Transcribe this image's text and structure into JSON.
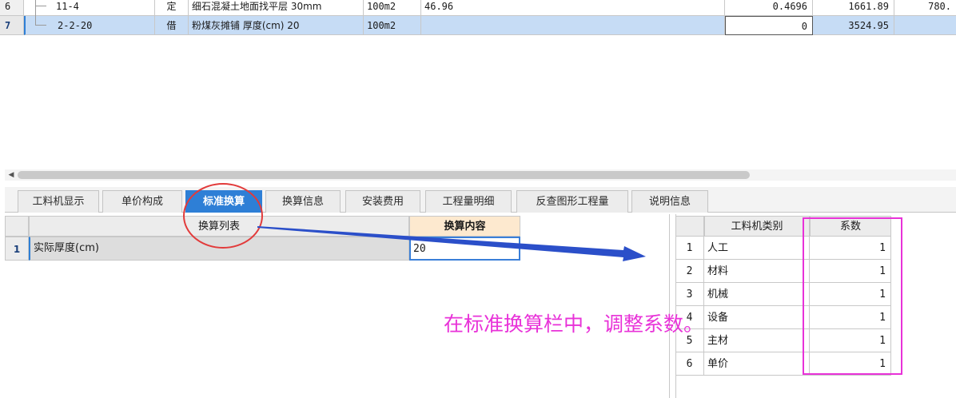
{
  "top_rows": [
    {
      "num": "6",
      "code": "11-4",
      "type": "定",
      "name": "细石混凝土地面找平层 30mm",
      "unit": "100m2",
      "expr": "46.96",
      "qty": "0.4696",
      "price": "1661.89",
      "total": "780."
    },
    {
      "num": "7",
      "code": "2-2-20",
      "type": "借",
      "name": "粉煤灰摊铺 厚度(cm) 20",
      "unit": "100m2",
      "expr": "",
      "qty": "0",
      "price": "3524.95",
      "total": ""
    }
  ],
  "tabs": [
    "工料机显示",
    "单价构成",
    "标准换算",
    "换算信息",
    "安装费用",
    "工程量明细",
    "反查图形工程量",
    "说明信息"
  ],
  "active_tab": "标准换算",
  "left_grid": {
    "headers": [
      "换算列表",
      "换算内容"
    ],
    "rows": [
      {
        "num": "1",
        "name": "实际厚度(cm)",
        "value": "20"
      }
    ]
  },
  "right_grid": {
    "headers": [
      "工料机类别",
      "系数"
    ],
    "rows": [
      {
        "num": "1",
        "category": "人工",
        "factor": "1"
      },
      {
        "num": "2",
        "category": "材料",
        "factor": "1"
      },
      {
        "num": "3",
        "category": "机械",
        "factor": "1"
      },
      {
        "num": "4",
        "category": "设备",
        "factor": "1"
      },
      {
        "num": "5",
        "category": "主材",
        "factor": "1"
      },
      {
        "num": "6",
        "category": "单价",
        "factor": "1"
      }
    ]
  },
  "annotation": "在标准换算栏中，调整系数。",
  "colors": {
    "accent": "#2e7fd6",
    "selection": "#c6dcf5",
    "header_orange": "#fde9cf",
    "annotation": "#e832d8",
    "circle": "#e23b3b",
    "arrow": "#2b4fc9"
  }
}
